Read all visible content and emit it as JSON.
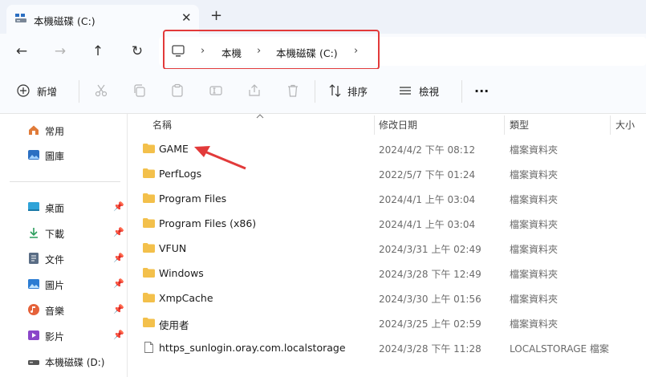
{
  "window": {
    "tab_title": "本機磁碟 (C:)",
    "tab_close": "✕",
    "new_tab": "+"
  },
  "nav": {
    "back": "←",
    "forward": "→",
    "up": "↑",
    "refresh": "↻",
    "crumb_sep": "›",
    "breadcrumbs": [
      "本機",
      "本機磁碟 (C:)"
    ]
  },
  "toolbar": {
    "new_label": "新增",
    "sort_label": "排序",
    "view_label": "檢視",
    "more": "···"
  },
  "sidebar": {
    "pin": "📌",
    "items": [
      {
        "label": "常用",
        "icon": "home-icon",
        "color": "#e07b39"
      },
      {
        "label": "圖庫",
        "icon": "gallery-icon",
        "color": "#2b6fc2"
      },
      {
        "label": "桌面",
        "icon": "desktop-icon",
        "color": "#2fa3d8"
      },
      {
        "label": "下載",
        "icon": "download-icon",
        "color": "#2a9d5c"
      },
      {
        "label": "文件",
        "icon": "document-icon",
        "color": "#5a6d85"
      },
      {
        "label": "圖片",
        "icon": "pictures-icon",
        "color": "#2b7cd3"
      },
      {
        "label": "音樂",
        "icon": "music-icon",
        "color": "#e5623a"
      },
      {
        "label": "影片",
        "icon": "video-icon",
        "color": "#8a46c9"
      },
      {
        "label": "本機磁碟 (D:)",
        "icon": "drive-icon",
        "color": "#555555"
      }
    ]
  },
  "columns": {
    "name": "名稱",
    "modified": "修改日期",
    "type": "類型",
    "size": "大小"
  },
  "files": [
    {
      "name": "GAME",
      "date": "2024/4/2 下午 08:12",
      "type": "檔案資料夾",
      "icon": "folder-icon"
    },
    {
      "name": "PerfLogs",
      "date": "2022/5/7 下午 01:24",
      "type": "檔案資料夾",
      "icon": "folder-icon"
    },
    {
      "name": "Program Files",
      "date": "2024/4/1 上午 03:04",
      "type": "檔案資料夾",
      "icon": "folder-icon"
    },
    {
      "name": "Program Files (x86)",
      "date": "2024/4/1 上午 03:04",
      "type": "檔案資料夾",
      "icon": "folder-icon"
    },
    {
      "name": "VFUN",
      "date": "2024/3/31 上午 02:49",
      "type": "檔案資料夾",
      "icon": "folder-icon"
    },
    {
      "name": "Windows",
      "date": "2024/3/28 下午 12:49",
      "type": "檔案資料夾",
      "icon": "folder-icon"
    },
    {
      "name": "XmpCache",
      "date": "2024/3/30 上午 01:56",
      "type": "檔案資料夾",
      "icon": "folder-icon"
    },
    {
      "name": "使用者",
      "date": "2024/3/25 上午 02:59",
      "type": "檔案資料夾",
      "icon": "folder-icon"
    },
    {
      "name": "https_sunlogin.oray.com.localstorage",
      "date": "2024/3/28 下午 11:28",
      "type": "LOCALSTORAGE 檔案",
      "icon": "file-icon"
    }
  ],
  "colors": {
    "folder": "#f3c04b",
    "highlight": "#e23a3a",
    "accent": "#2b6fc2"
  }
}
